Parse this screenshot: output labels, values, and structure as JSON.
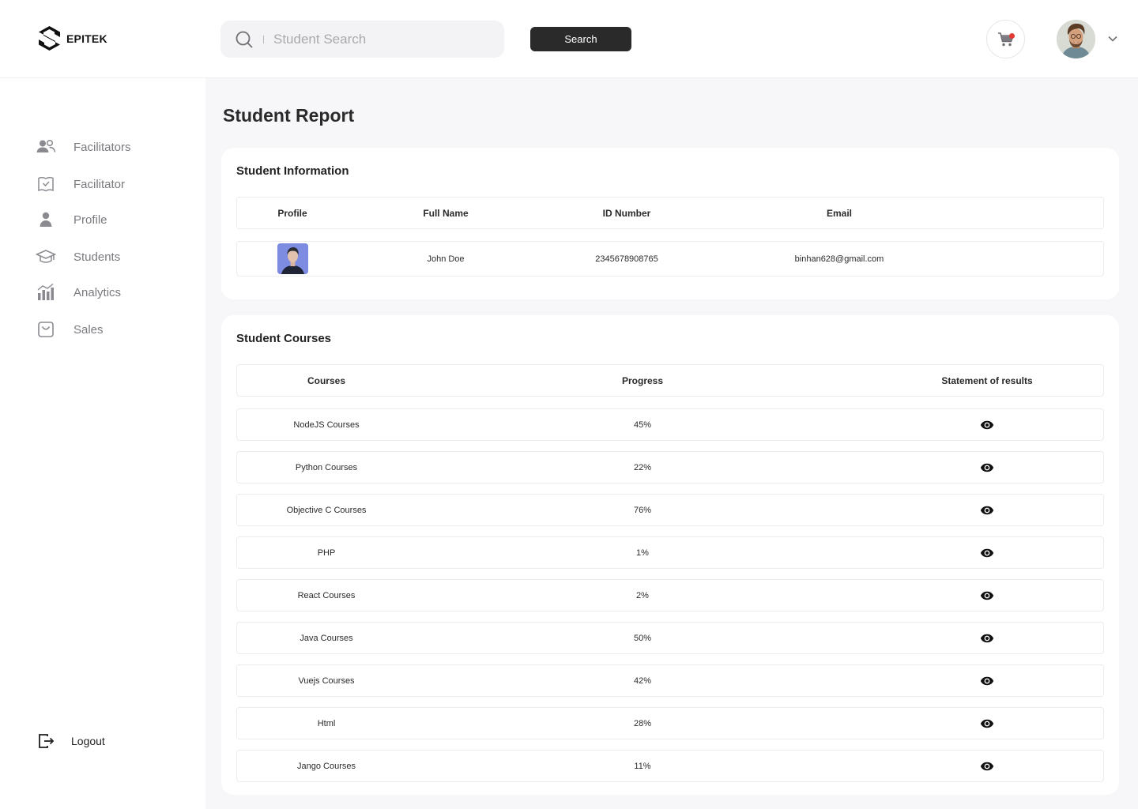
{
  "brand": {
    "name": "EPITEK"
  },
  "search": {
    "placeholder": "Student Search",
    "button_label": "Search"
  },
  "sidebar": {
    "items": [
      {
        "label": "Facilitators",
        "icon": "users-icon"
      },
      {
        "label": "Facilitator",
        "icon": "book-icon"
      },
      {
        "label": "Profile",
        "icon": "user-icon"
      },
      {
        "label": "Students",
        "icon": "graduation-cap-icon"
      },
      {
        "label": "Analytics",
        "icon": "bar-chart-icon"
      },
      {
        "label": "Sales",
        "icon": "shopping-bag-icon"
      }
    ],
    "logout_label": "Logout"
  },
  "page": {
    "title": "Student Report"
  },
  "student_info": {
    "title": "Student Information",
    "columns": [
      "Profile",
      "Full Name",
      "ID Number",
      "Email"
    ],
    "row": {
      "full_name": "John Doe",
      "id_number": "2345678908765",
      "email": "binhan628@gmail.com"
    }
  },
  "student_courses": {
    "title": "Student Courses",
    "columns": [
      "Courses",
      "Progress",
      "Statement of results"
    ],
    "rows": [
      {
        "course": "NodeJS Courses",
        "progress": "45%"
      },
      {
        "course": "Python Courses",
        "progress": "22%"
      },
      {
        "course": "Objective C Courses",
        "progress": "76%"
      },
      {
        "course": "PHP",
        "progress": "1%"
      },
      {
        "course": "React Courses",
        "progress": "2%"
      },
      {
        "course": "Java Courses",
        "progress": "50%"
      },
      {
        "course": "Vuejs Courses",
        "progress": "42%"
      },
      {
        "course": "Html",
        "progress": "28%"
      },
      {
        "course": "Jango Courses",
        "progress": "11%"
      }
    ]
  },
  "colors": {
    "accent": "#2a2a2a",
    "notification": "#e53935",
    "background": "#f7f7f9"
  }
}
